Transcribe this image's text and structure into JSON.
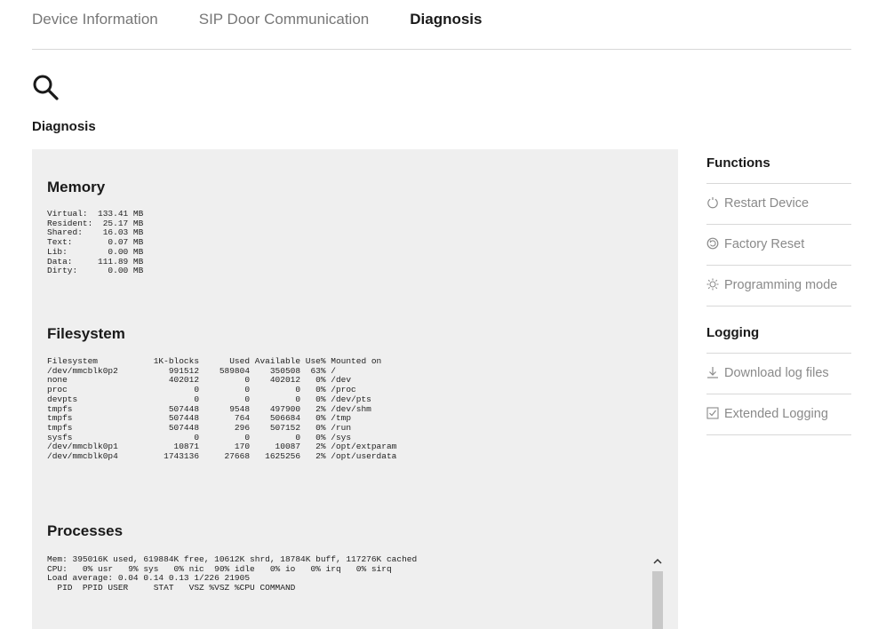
{
  "tabs": [
    {
      "label": "Device Information",
      "active": false
    },
    {
      "label": "SIP Door Communication",
      "active": false
    },
    {
      "label": "Diagnosis",
      "active": true
    }
  ],
  "page": {
    "icon": "search-icon",
    "title": "Diagnosis"
  },
  "memory": {
    "title": "Memory",
    "text": "Virtual:  133.41 MB\nResident:  25.17 MB\nShared:    16.03 MB\nText:       0.07 MB\nLib:        0.00 MB\nData:     111.89 MB\nDirty:      0.00 MB"
  },
  "filesystem": {
    "title": "Filesystem",
    "text": "Filesystem           1K-blocks      Used Available Use% Mounted on\n/dev/mmcblk0p2          991512    589804    350508  63% /\nnone                    402012         0    402012   0% /dev\nproc                         0         0         0   0% /proc\ndevpts                       0         0         0   0% /dev/pts\ntmpfs                   507448      9548    497900   2% /dev/shm\ntmpfs                   507448       764    506684   0% /tmp\ntmpfs                   507448       296    507152   0% /run\nsysfs                        0         0         0   0% /sys\n/dev/mmcblk0p1           10871       170     10087   2% /opt/extparam\n/dev/mmcblk0p4         1743136     27668   1625256   2% /opt/userdata"
  },
  "processes": {
    "title": "Processes",
    "text": "Mem: 395016K used, 619884K free, 10612K shrd, 18784K buff, 117276K cached\nCPU:   0% usr   9% sys   0% nic  90% idle   0% io   0% irq   0% sirq\nLoad average: 0.04 0.14 0.13 1/226 21905\n  PID  PPID USER     STAT   VSZ %VSZ %CPU COMMAND"
  },
  "sidebar": {
    "functions_heading": "Functions",
    "functions": [
      {
        "label": "Restart Device",
        "icon": "power-icon"
      },
      {
        "label": "Factory Reset",
        "icon": "factory-reset-icon"
      },
      {
        "label": "Programming mode",
        "icon": "programming-mode-icon"
      }
    ],
    "logging_heading": "Logging",
    "logging": [
      {
        "label": "Download log files",
        "icon": "download-icon"
      },
      {
        "label": "Extended Logging",
        "icon": "checkbox-icon"
      }
    ]
  }
}
